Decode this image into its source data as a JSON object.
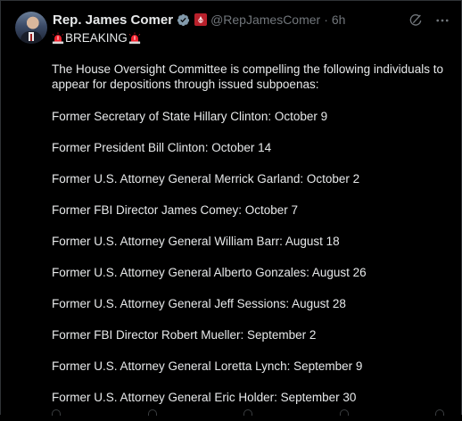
{
  "post": {
    "author_name": "Rep. James Comer",
    "handle": "@RepJamesComer",
    "separator": "·",
    "timestamp": "6h",
    "breaking_label": "BREAKING",
    "intro": "The House Oversight Committee is compelling the following individuals to appear for depositions through issued subpoenas:",
    "subpoenas": [
      "Former Secretary of State Hillary Clinton: October 9",
      "Former President Bill Clinton: October 14",
      "Former U.S. Attorney General Merrick Garland: October 2",
      "Former FBI Director James Comey: October 7",
      "Former U.S. Attorney General William Barr: August 18",
      "Former U.S. Attorney General Alberto Gonzales: August 26",
      "Former U.S. Attorney General Jeff Sessions: August 28",
      "Former FBI Director Robert Mueller: September 2",
      "Former U.S. Attorney General Loretta Lynch: September 9",
      "Former U.S. Attorney General Eric Holder: September 30"
    ]
  },
  "icons": {
    "verified": "verified-badge-icon",
    "affiliation": "government-affiliation-icon",
    "grok": "grok-icon",
    "more": "more-options-icon",
    "siren": "police-siren-icon"
  },
  "colors": {
    "background": "#000000",
    "text": "#e7e9ea",
    "muted": "#71767b",
    "verified": "#829aab",
    "affiliation": "#b8202b",
    "siren": "#f4212e"
  }
}
